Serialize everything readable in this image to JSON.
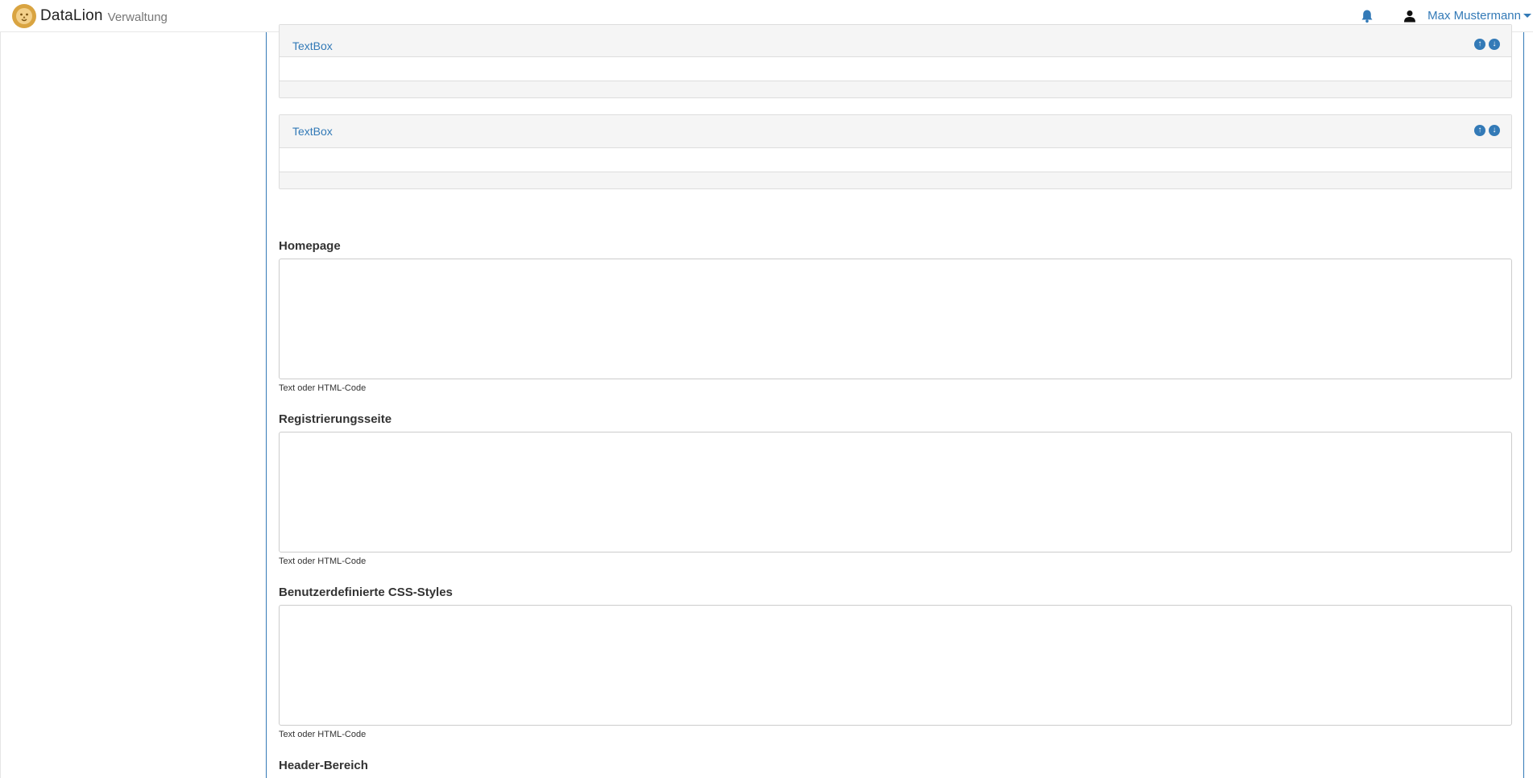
{
  "header": {
    "brand_name": "DataLion",
    "brand_sub": "Verwaltung",
    "user_name": "Max Mustermann"
  },
  "panels": [
    {
      "title": "TextBox"
    },
    {
      "title": "TextBox"
    }
  ],
  "fields": [
    {
      "label": "Homepage",
      "help": "Text oder HTML-Code",
      "value": ""
    },
    {
      "label": "Registrierungsseite",
      "help": "Text oder HTML-Code",
      "value": ""
    },
    {
      "label": "Benutzerdefinierte CSS-Styles",
      "help": "Text oder HTML-Code",
      "value": ""
    },
    {
      "label": "Header-Bereich"
    }
  ],
  "icons": {
    "logo": "lion-logo-icon",
    "notifications": "bell-icon",
    "user": "user-icon",
    "move_up": "arrow-up-circle-icon",
    "move_down": "arrow-down-circle-icon"
  },
  "colors": {
    "accent": "#337ab7",
    "logo": "#d9a441",
    "panel_bg": "#f5f5f5",
    "border": "#dddddd"
  }
}
